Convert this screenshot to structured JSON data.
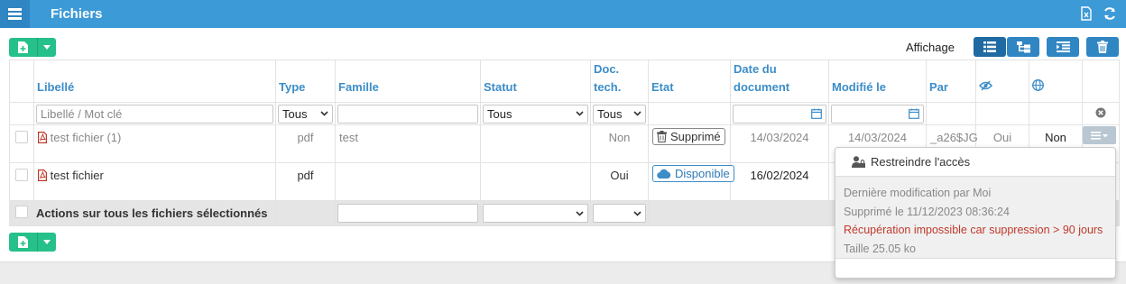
{
  "header": {
    "title": "Fichiers",
    "menu_icon": "hamburger-icon",
    "export_icon": "excel-export-icon",
    "refresh_icon": "refresh-icon"
  },
  "toolbar": {
    "display_label": "Affichage"
  },
  "columns": {
    "libelle": "Libellé",
    "type": "Type",
    "famille": "Famille",
    "statut": "Statut",
    "doc_tech_1": "Doc.",
    "doc_tech_2": "tech.",
    "etat": "Etat",
    "date_doc_1": "Date du",
    "date_doc_2": "document",
    "modifie": "Modifié le",
    "par": "Par"
  },
  "filters": {
    "libelle_placeholder": "Libellé / Mot clé",
    "type": "Tous",
    "statut": "Tous",
    "doc_tech": "Tous"
  },
  "rows": [
    {
      "name": "test fichier (1)",
      "type": "pdf",
      "famille": "test",
      "doc_tech": "Non",
      "etat": "Supprimé",
      "date_doc": "14/03/2024",
      "modifie": "14/03/2024",
      "par": "_a26$JG",
      "hidden": "Oui",
      "public": "Non"
    },
    {
      "name": "test fichier",
      "type": "pdf",
      "famille": "",
      "doc_tech": "Oui",
      "etat": "Disponible",
      "date_doc": "16/02/2024"
    }
  ],
  "bulk": {
    "label": "Actions sur tous les fichiers sélectionnés"
  },
  "popup": {
    "restrict": "Restreindre l'accès",
    "last_mod": "Dernière modification par Moi",
    "deleted": "Supprimé le 11/12/2023 08:36:24",
    "warning": "Récupération impossible car suppression > 90 jours",
    "size": "Taille 25.05 ko"
  },
  "colors": {
    "accent": "#3c9ad7",
    "green": "#26c08a",
    "warning": "#c0392b"
  }
}
